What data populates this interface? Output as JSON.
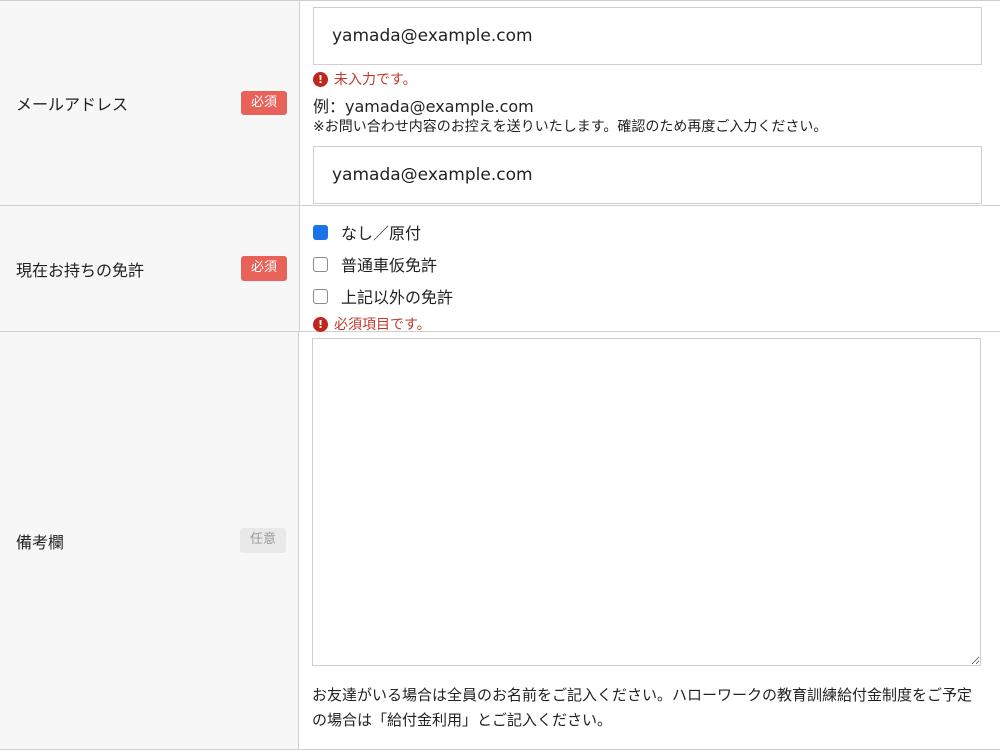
{
  "email": {
    "label": "メールアドレス",
    "badge": "必須",
    "value": "yamada@example.com",
    "error": "未入力です。",
    "example": "例：yamada@example.com",
    "note": "※お問い合わせ内容のお控えを送りいたします。確認のため再度ご入力ください。",
    "confirm_value": "yamada@example.com"
  },
  "license": {
    "label": "現在お持ちの免許",
    "badge": "必須",
    "options": [
      {
        "label": "なし／原付",
        "checked": true
      },
      {
        "label": "普通車仮免許",
        "checked": false
      },
      {
        "label": "上記以外の免許",
        "checked": false
      }
    ],
    "error": "必須項目です。"
  },
  "remarks": {
    "label": "備考欄",
    "badge": "任意",
    "value": "",
    "help": "お友達がいる場合は全員のお名前をご記入ください。ハローワークの教育訓練給付金制度をご予定の場合は「給付金利用」とご記入ください。"
  },
  "colors": {
    "required_badge": "#e8625a",
    "optional_badge": "#e9e9e9",
    "error_text": "#c0392b",
    "checkbox_checked": "#1a73e8",
    "label_bg": "#f7f7f7"
  },
  "icons": {
    "error": "exclamation-circle-icon",
    "check": "checkmark-icon"
  }
}
